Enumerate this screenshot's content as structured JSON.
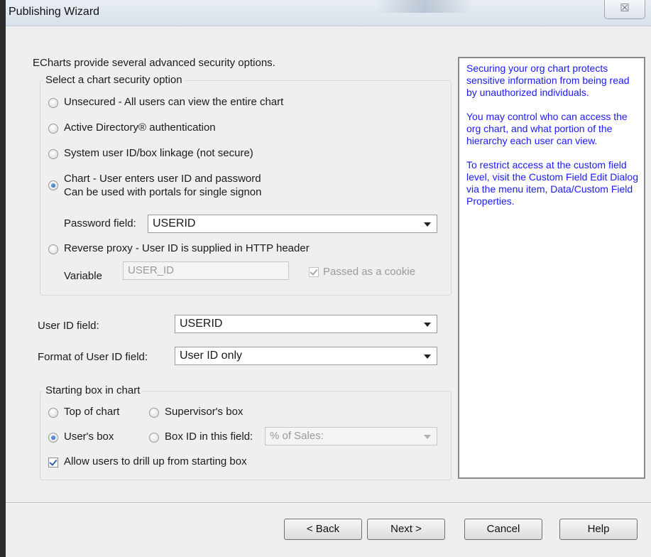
{
  "window": {
    "title": "Publishing Wizard",
    "close_glyph": "☒"
  },
  "intro": "ECharts provide several advanced security options.",
  "security_group": {
    "label": "Select a chart security option",
    "options": [
      {
        "label": "Unsecured - All users can view the entire chart",
        "checked": false
      },
      {
        "label": "Active Directory® authentication",
        "checked": false
      },
      {
        "label": "System user ID/box linkage (not secure)",
        "checked": false
      },
      {
        "label": "Chart - User enters user ID and password",
        "label2": "Can be used with portals for single signon",
        "checked": true
      },
      {
        "label": "Reverse proxy - User ID is supplied in HTTP header",
        "checked": false
      }
    ],
    "password_field_label": "Password field:",
    "password_field_value": "USERID",
    "variable_label": "Variable",
    "variable_value": "USER_ID",
    "passed_cookie_label": "Passed as a cookie",
    "passed_cookie_checked": true
  },
  "user_id_field": {
    "label": "User ID field:",
    "value": "USERID"
  },
  "format_field": {
    "label": "Format of User ID field:",
    "value": "User ID only"
  },
  "starting_group": {
    "label": "Starting box in chart",
    "top_of_chart": "Top of chart",
    "supervisors_box": "Supervisor's box",
    "users_box": "User's box",
    "box_id_field": "Box ID in this field:",
    "box_id_value": "% of Sales:",
    "selected": "users_box",
    "allow_drill_label": "Allow users to drill up from starting box",
    "allow_drill_checked": true
  },
  "help_text": [
    "Securing your org chart protects sensitive information from being read by unauthorized individuals.",
    "You may control who can access the org chart, and what portion of the hierarchy each user can view.",
    "To restrict access at the custom field level, visit the Custom Field Edit Dialog via the menu item, Data/Custom Field Properties."
  ],
  "buttons": {
    "back": "< Back",
    "next": "Next >",
    "cancel": "Cancel",
    "help": "Help"
  },
  "colors": {
    "help_text": "#1a1aff",
    "accent_radio": "#1c5fb8"
  }
}
